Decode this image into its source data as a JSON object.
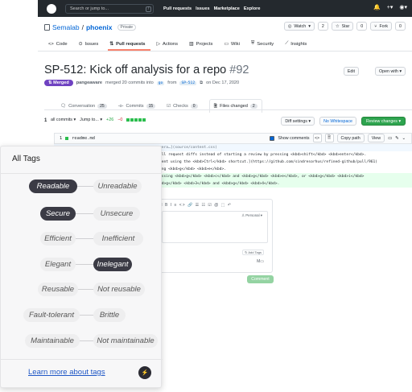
{
  "header": {
    "search_placeholder": "Search or jump to...",
    "search_shortcut": "/",
    "nav": [
      "Pull requests",
      "Issues",
      "Marketplace",
      "Explore"
    ],
    "right_icons": [
      "bell-icon",
      "plus-icon",
      "avatar"
    ]
  },
  "repo": {
    "owner": "Semalab",
    "separator": "/",
    "name": "phoenix",
    "visibility": "Private",
    "watch_label": "Watch",
    "watch_count": "2",
    "star_label": "Star",
    "star_count": "0",
    "fork_label": "Fork",
    "fork_count": "0",
    "tabs": [
      {
        "label": "Code",
        "icon": "code-icon"
      },
      {
        "label": "Issues",
        "icon": "issue-icon"
      },
      {
        "label": "Pull requests",
        "icon": "pr-icon"
      },
      {
        "label": "Actions",
        "icon": "play-icon"
      },
      {
        "label": "Projects",
        "icon": "project-icon"
      },
      {
        "label": "Wiki",
        "icon": "book-icon"
      },
      {
        "label": "Security",
        "icon": "shield-icon"
      },
      {
        "label": "Insights",
        "icon": "graph-icon"
      }
    ]
  },
  "pr": {
    "title": "SP-512: Kick off analysis for a repo",
    "number": "#92",
    "status": "Merged",
    "author": "pangeaware",
    "merge_text": "merged 20 commits into",
    "base_branch": "go",
    "from_text": "from",
    "head_branch": "SP-512",
    "date_text": "on Dec 17, 2020",
    "edit_label": "Edit",
    "open_with_label": "Open with ▾",
    "tabs": [
      {
        "label": "Conversation",
        "count": "25"
      },
      {
        "label": "Commits",
        "count": "15"
      },
      {
        "label": "Checks",
        "count": "0"
      },
      {
        "label": "Files changed",
        "count": "2"
      }
    ]
  },
  "diff": {
    "commits_selector": "all commits ▾",
    "jump_to": "Jump to... ▾",
    "additions": "+26",
    "deletions": "−0",
    "settings_label": "Diff settings ▾",
    "whitespace_label": "No Whitespace",
    "review_label": "Review changes ▾",
    "file_change_count": "1",
    "file_name": "readme.md",
    "show_comments_label": "Show comments",
    "copy_path_label": "Copy path",
    "view_label": "View",
    "lines": [
      "mera…](source/content.css)",
      "ull request diffs instead of starting a review by pressing <kbd>shift</kbd> <kbd>enter</kbd>.",
      "ment using the <kbd>Ctrl</kbd> shortcut.](https://github.com/sindresorhus/refined-github/pull/961)",
      "ing <kbd>g</kbd> <kbd>e</kbd>.",
      "essing <kbd>g</kbd> <kbd>c</kbd> and <kbd>g</kbd> <kbd>e</kbd>, or <kbd>g</kbd> <kbd>i</kbd>",
      "bd>g</kbd> <kbd>3</kbd> and <kbd>g</kbd> <kbd>4</kbd>."
    ]
  },
  "editor": {
    "toolbar": "H B I  ≡ <> 🔗  ☰ ☷ ☑  @ ⬚ ↶",
    "personal_label": "♙ Personal ▾",
    "add_tags_label": "↻ Add Tags",
    "comment_label": "Comment"
  },
  "tags_panel": {
    "title": "All Tags",
    "pairs": [
      {
        "left": "Readable",
        "right": "Unreadable",
        "selected": "left"
      },
      {
        "left": "Secure",
        "right": "Unsecure",
        "selected": "left"
      },
      {
        "left": "Efficient",
        "right": "Inefficient",
        "selected": "none"
      },
      {
        "left": "Elegant",
        "right": "Inelegant",
        "selected": "right"
      },
      {
        "left": "Reusable",
        "right": "Not reusable",
        "selected": "none"
      },
      {
        "left": "Fault-tolerant",
        "right": "Brittle",
        "selected": "none"
      },
      {
        "left": "Maintainable",
        "right": "Not maintainable",
        "selected": "none"
      }
    ],
    "learn_more": "Learn more about tags",
    "brand_icon": "sema-logo-icon",
    "colors": {
      "selected_bg": "#3b3b45",
      "unselected_bg": "#eeeeef",
      "link": "#1f57c6"
    }
  }
}
